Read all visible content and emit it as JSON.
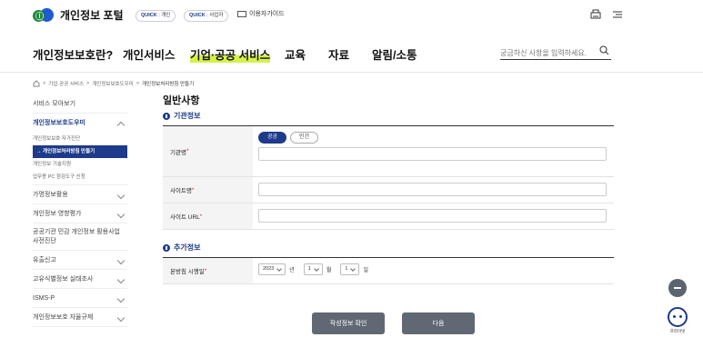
{
  "header": {
    "logo_text": "개인정보 포털",
    "quick1_prefix": "QUICK",
    "quick1_label": "개인",
    "quick2_prefix": "QUICK",
    "quick2_label": "사업자",
    "guide_label": "이용자가이드"
  },
  "gnb": {
    "items": [
      "개인정보보호란?",
      "개인서비스",
      "기업·공공 서비스",
      "교육",
      "자료",
      "알림/소통"
    ],
    "active_index": 2,
    "search_placeholder": "궁금하신 사항을 입력하세요."
  },
  "breadcrumb": {
    "items": [
      "기업·공공 서비스",
      "개인정보보호도우미",
      "개인정보처리방침 만들기"
    ],
    "separator": ">"
  },
  "sidebar": {
    "items": [
      {
        "label": "서비스 모아보기"
      },
      {
        "label": "개인정보보호도우미"
      },
      {
        "label": "개인정보보호 자가진단"
      },
      {
        "label": "→ 개인정보처리방침 만들기"
      },
      {
        "label": "개인정보 기술지원"
      },
      {
        "label": "업무용 PC 점검도구 신청"
      },
      {
        "label": "가명정보활용"
      },
      {
        "label": "개인정보 영향평가"
      },
      {
        "label": "공공기관 민감 개인정보 활용사업 사전진단"
      },
      {
        "label": "유출신고"
      },
      {
        "label": "고유식별정보 실태조사"
      },
      {
        "label": "ISMS-P"
      },
      {
        "label": "개인정보보호 자율규제"
      }
    ]
  },
  "main": {
    "title": "일반사항",
    "section1_title": "기관정보",
    "org_label": "기관명",
    "org_types": [
      "공공",
      "민간"
    ],
    "site_name_label": "사이트명",
    "site_url_label": "사이트 URL",
    "section2_title": "추가정보",
    "date_label": "본방침 시행일",
    "year_value": "2023",
    "year_unit": "년",
    "month_value": "1",
    "month_unit": "월",
    "day_value": "1",
    "day_unit": "일",
    "required_mark": "*"
  },
  "buttons": {
    "check_label": "작성정보 확인",
    "next_label": "다음"
  },
  "chatbot": {
    "label": "프라이빗"
  },
  "colors": {
    "primary": "#1e3a8a",
    "highlight": "#d6f24a",
    "button": "#606874",
    "required": "#d93025"
  }
}
